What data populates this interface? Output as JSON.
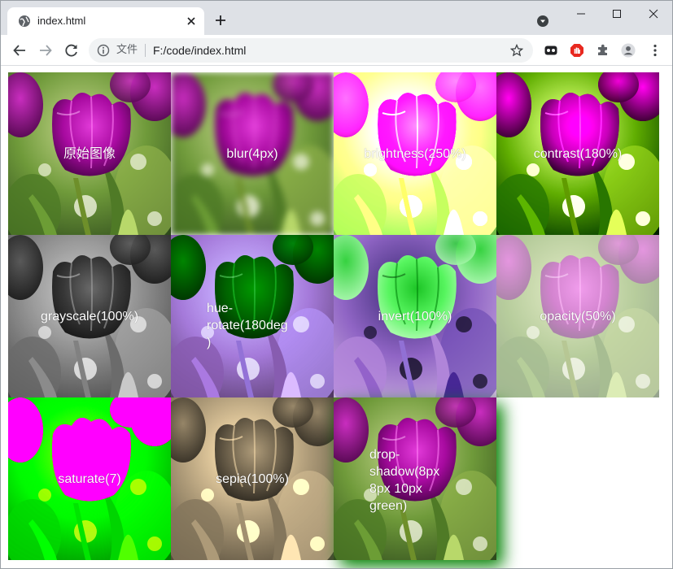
{
  "tab": {
    "title": "index.html"
  },
  "address": {
    "site_label": "文件",
    "url": "F:/code/index.html"
  },
  "icons": {
    "tab_favicon": "globe-icon",
    "tab_close": "close-icon",
    "new_tab": "plus-icon",
    "tab_search": "tab-search-icon",
    "minimize": "minimize-icon",
    "maximize": "maximize-icon",
    "close": "close-icon",
    "back": "back-arrow-icon",
    "forward": "forward-arrow-icon",
    "reload": "reload-icon",
    "info": "info-icon",
    "bookmark": "star-icon",
    "ext1": "mask-extension-icon",
    "ext2": "adblock-extension-icon",
    "extensions": "puzzle-icon",
    "profile": "avatar-icon",
    "menu": "kebab-menu-icon"
  },
  "filters": [
    {
      "label": "原始图像",
      "css": "none"
    },
    {
      "label": "blur(4px)",
      "css": "blur(4px)"
    },
    {
      "label": "brightness(250%)",
      "css": "brightness(250%)"
    },
    {
      "label": "contrast(180%)",
      "css": "contrast(180%)"
    },
    {
      "label": "grayscale(100%)",
      "css": "grayscale(100%)"
    },
    {
      "label": "hue-rotate(180deg)",
      "css": "hue-rotate(180deg)"
    },
    {
      "label": "invert(100%)",
      "css": "invert(100%)"
    },
    {
      "label": "opacity(50%)",
      "css": "opacity(50%)"
    },
    {
      "label": "saturate(7)",
      "css": "saturate(7)"
    },
    {
      "label": "sepia(100%)",
      "css": "sepia(100%)"
    },
    {
      "label": "drop-shadow(8px 8px 10px green)",
      "css": "drop-shadow(8px 8px 10px green)"
    }
  ]
}
